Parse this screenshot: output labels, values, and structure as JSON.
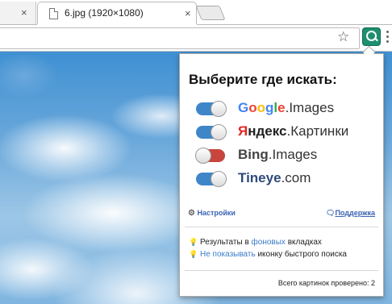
{
  "tabs": {
    "active_title": "6.jpg (1920×1080)",
    "close_glyph": "×"
  },
  "toolbar": {
    "bookmark_star": "☆"
  },
  "popup": {
    "title": "Выберите где искать:",
    "engines": [
      {
        "brand": "Google",
        "suffix": ".Images",
        "enabled": true,
        "brand_colors": [
          "#4285f4",
          "#ea4335",
          "#fbbc05",
          "#4285f4",
          "#34a853",
          "#ea4335"
        ]
      },
      {
        "brand_first": "Я",
        "brand_rest": "ндекс",
        "suffix": ".Картинки",
        "enabled": true
      },
      {
        "brand": "Bing",
        "suffix": ".Images",
        "enabled": false
      },
      {
        "brand": "Tineye",
        "suffix": ".com",
        "enabled": true
      }
    ],
    "settings_label": "Настройки",
    "support_label": "Поддержка",
    "option1": {
      "before": "Результаты в ",
      "link": "фоновых",
      "after": " вкладках"
    },
    "option2": {
      "link": "Не показывать",
      "after": " иконку быстрого поиска"
    },
    "counter_text": "Всего картинок проверено: 2"
  },
  "colors": {
    "toggle_on": "#3f86c8",
    "toggle_off": "#c8453d",
    "link": "#3a64b3",
    "extension_icon": "#1e8f6e"
  }
}
